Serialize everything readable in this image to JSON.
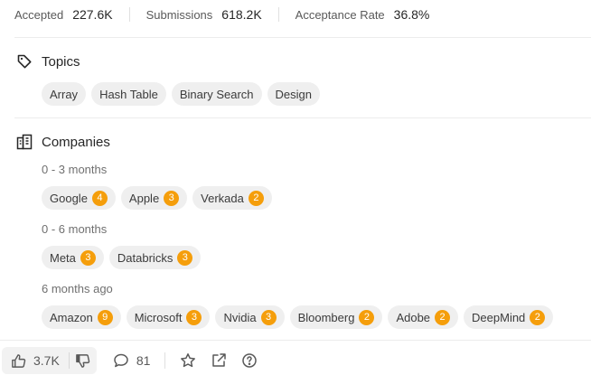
{
  "stats": [
    {
      "label": "Accepted",
      "value": "227.6K"
    },
    {
      "label": "Submissions",
      "value": "618.2K"
    },
    {
      "label": "Acceptance Rate",
      "value": "36.8%"
    }
  ],
  "topics": {
    "title": "Topics",
    "tags": [
      "Array",
      "Hash Table",
      "Binary Search",
      "Design"
    ]
  },
  "companies": {
    "title": "Companies",
    "groups": [
      {
        "period": "0 - 3 months",
        "items": [
          {
            "name": "Google",
            "count": "4"
          },
          {
            "name": "Apple",
            "count": "3"
          },
          {
            "name": "Verkada",
            "count": "2"
          }
        ]
      },
      {
        "period": "0 - 6 months",
        "items": [
          {
            "name": "Meta",
            "count": "3"
          },
          {
            "name": "Databricks",
            "count": "3"
          }
        ]
      },
      {
        "period": "6 months ago",
        "items": [
          {
            "name": "Amazon",
            "count": "9"
          },
          {
            "name": "Microsoft",
            "count": "3"
          },
          {
            "name": "Nvidia",
            "count": "3"
          },
          {
            "name": "Bloomberg",
            "count": "2"
          },
          {
            "name": "Adobe",
            "count": "2"
          },
          {
            "name": "DeepMind",
            "count": "2"
          }
        ]
      }
    ]
  },
  "footer": {
    "likes": "3.7K",
    "comments": "81",
    "icons": [
      "thumbs-up-icon",
      "thumbs-down-icon",
      "comment-icon",
      "star-icon",
      "share-icon",
      "help-icon"
    ]
  },
  "colors": {
    "badge": "#f59e0b",
    "chip_bg": "#efefef",
    "text": "#262626"
  }
}
